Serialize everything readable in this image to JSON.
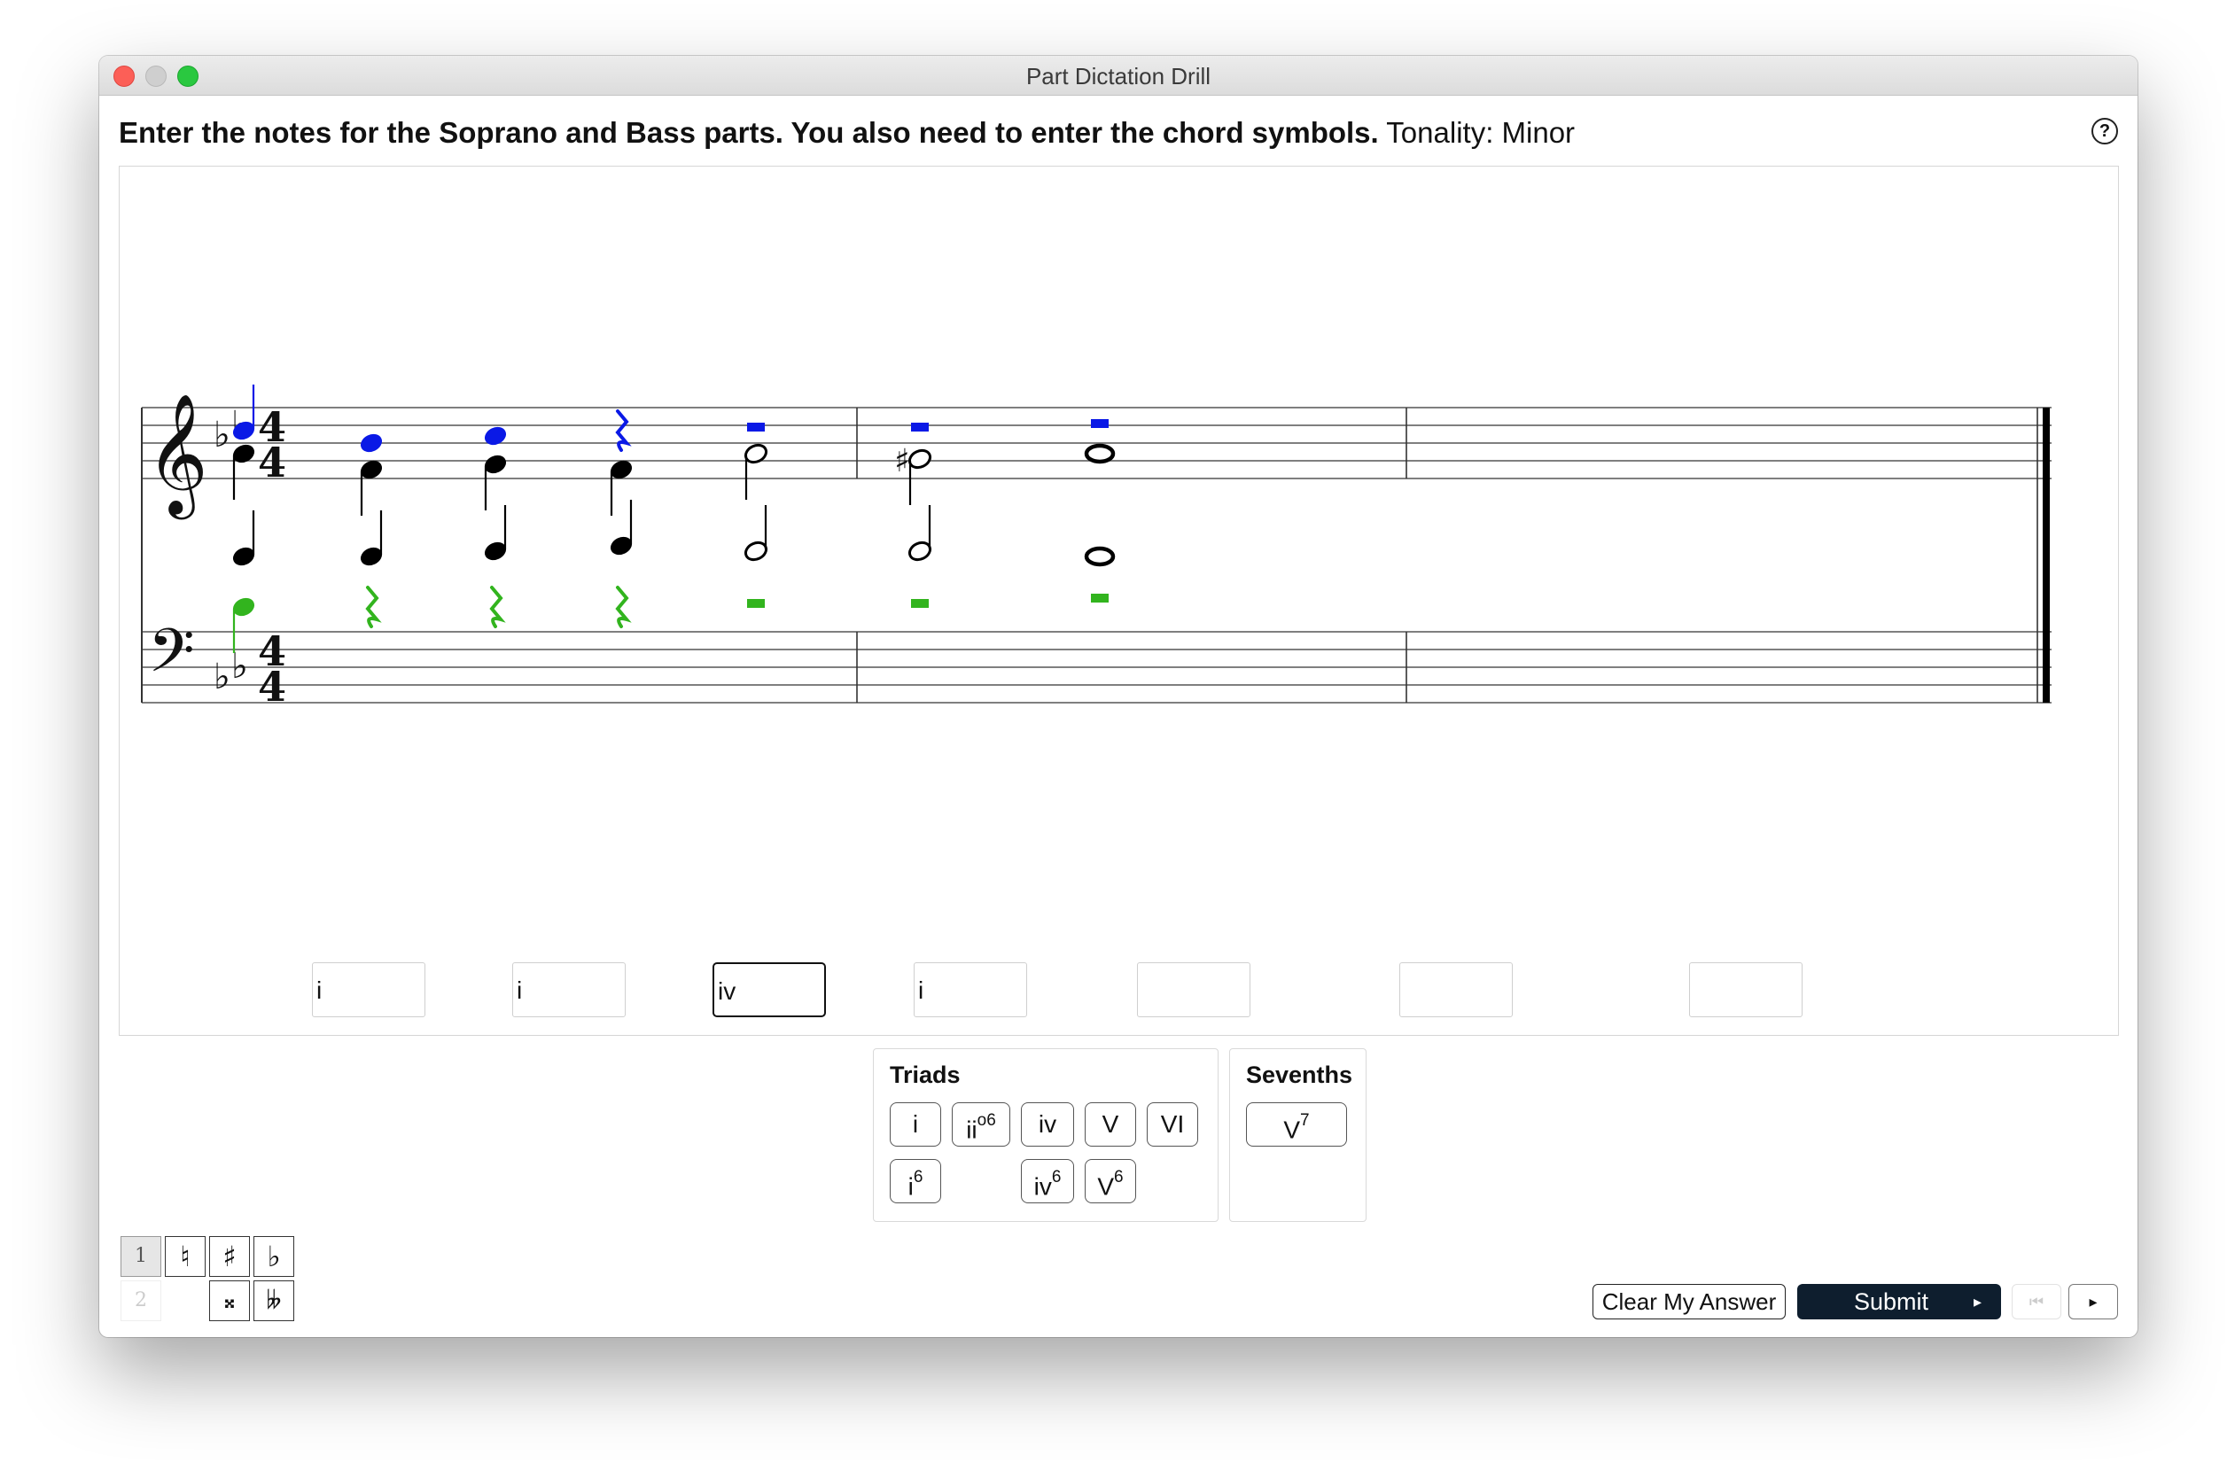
{
  "window": {
    "title": "Part Dictation Drill"
  },
  "instruction": {
    "bold": "Enter the notes for the Soprano and Bass parts. You also need to enter the chord symbols.",
    "tonality": "Tonality: Minor"
  },
  "help_icon": "?",
  "score": {
    "time_signature": "4/4",
    "key_signature": "two flats",
    "colors": {
      "soprano_entry": "#0a19e6",
      "bass_entry": "#32b41e",
      "given_notes": "#000000"
    }
  },
  "chord_symbols": [
    "i",
    "i",
    "iv",
    "i",
    "",
    "",
    ""
  ],
  "palette": {
    "triads": {
      "title": "Triads",
      "row1": [
        {
          "base": "i",
          "sup": ""
        },
        {
          "base": "ii",
          "sup": "o6"
        },
        {
          "base": "iv",
          "sup": ""
        },
        {
          "base": "V",
          "sup": ""
        },
        {
          "base": "VI",
          "sup": ""
        }
      ],
      "row2": [
        {
          "base": "i",
          "sup": "6"
        },
        {
          "base": "iv",
          "sup": "6"
        },
        {
          "base": "V",
          "sup": "6"
        }
      ]
    },
    "sevenths": {
      "title": "Sevenths",
      "buttons": [
        {
          "base": "V",
          "sup": "7"
        }
      ]
    }
  },
  "accidentals": {
    "voice1": "1",
    "voice2": "2",
    "natural": "♮",
    "sharp": "♯",
    "flat": "♭",
    "double_sharp": "𝄪",
    "double_flat": "𝄫"
  },
  "buttons": {
    "clear": "Clear My Answer",
    "submit": "Submit",
    "submit_arrow": "▸",
    "first": "⏮",
    "next": "▸"
  }
}
